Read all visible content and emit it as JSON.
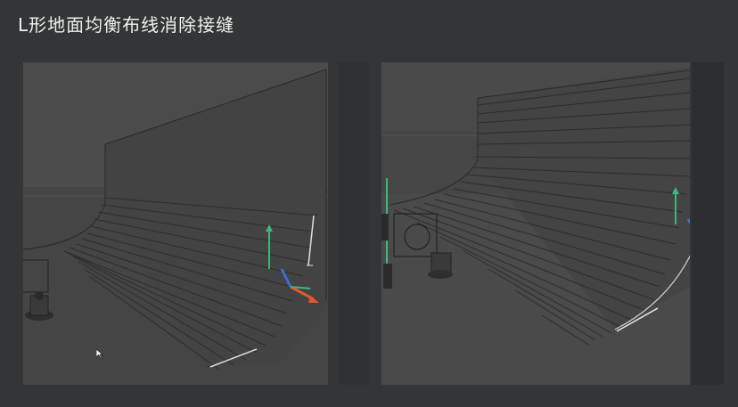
{
  "title": "L形地面均衡布线消除接缝",
  "colors": {
    "background": "#333536",
    "viewport": "#4a4a4a",
    "wireframe": "#2a2a2a",
    "axis_y": "#3cb878",
    "axis_x": "#e05a2c",
    "axis_z": "#3a6fd8"
  },
  "viewports": [
    {
      "name": "before-view"
    },
    {
      "name": "after-view"
    }
  ]
}
